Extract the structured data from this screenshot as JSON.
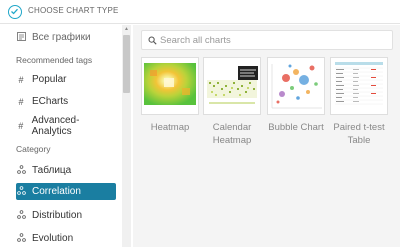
{
  "header": {
    "title": "CHOOSE CHART TYPE"
  },
  "sidebar": {
    "all_charts": "Все графики",
    "recommended_title": "Recommended tags",
    "tags": [
      {
        "label": "Popular"
      },
      {
        "label": "ECharts"
      },
      {
        "label": "Advanced-Analytics"
      }
    ],
    "category_title": "Category",
    "categories": [
      {
        "label": "Таблица",
        "active": false
      },
      {
        "label": "Correlation",
        "active": true
      },
      {
        "label": "Distribution",
        "active": false
      },
      {
        "label": "Evolution",
        "active": false
      }
    ]
  },
  "search": {
    "placeholder": "Search all charts",
    "value": ""
  },
  "charts": [
    {
      "label": "Heatmap"
    },
    {
      "label": "Calendar Heatmap"
    },
    {
      "label": "Bubble Chart"
    },
    {
      "label": "Paired t-test Table"
    }
  ],
  "colors": {
    "accent": "#20a7c9",
    "active_bg": "#1a7ea1"
  }
}
